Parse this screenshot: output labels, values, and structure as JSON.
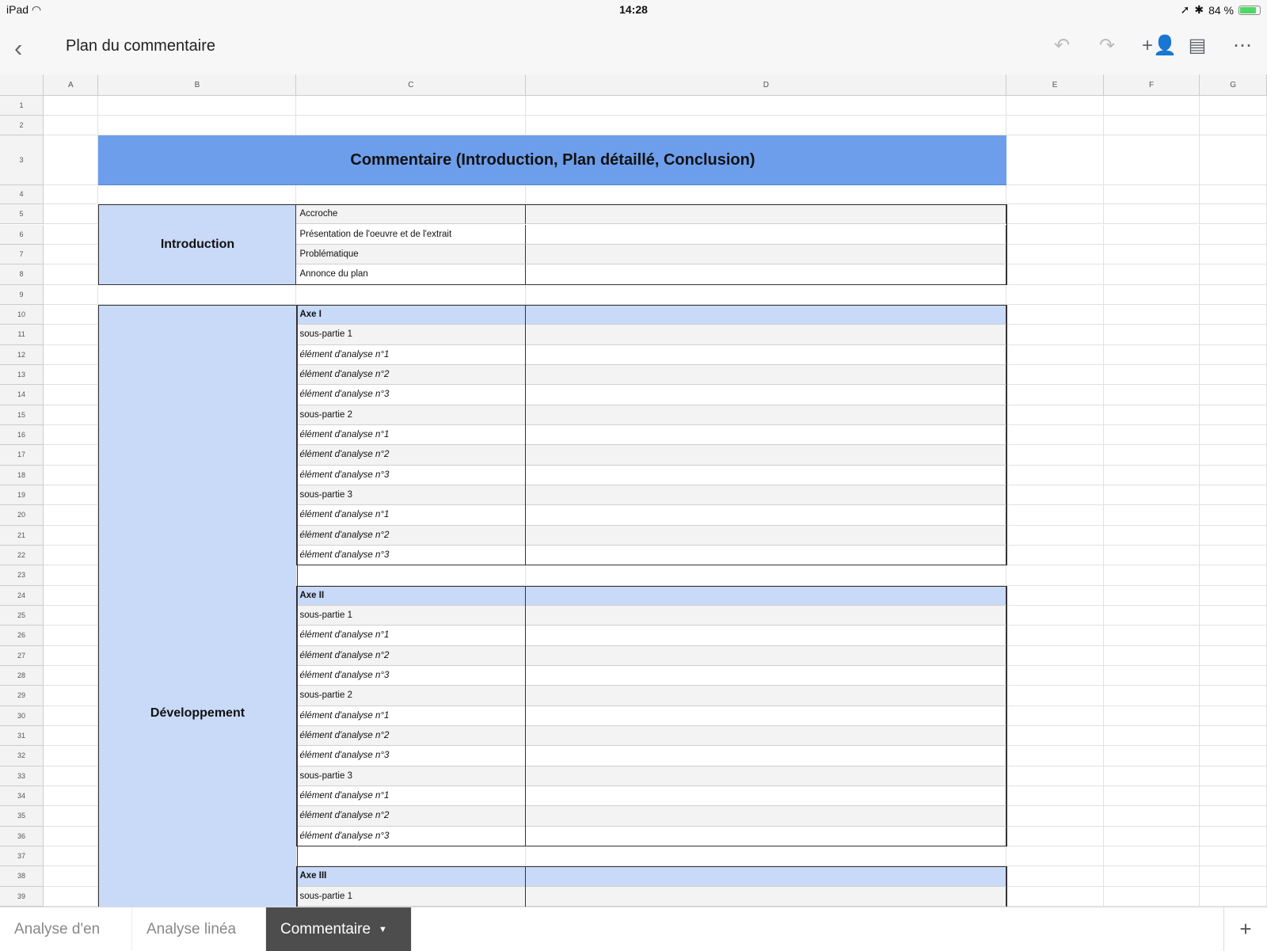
{
  "status_bar": {
    "device": "iPad",
    "time": "14:28",
    "battery": "84 %",
    "battery_level": 0.84,
    "icons": [
      "wifi-icon",
      "location-icon",
      "bluetooth-icon",
      "battery-icon"
    ]
  },
  "app_bar": {
    "title": "Plan du commentaire",
    "icons": [
      "back-icon",
      "undo-icon",
      "redo-icon",
      "add-person-icon",
      "comment-icon",
      "more-icon"
    ]
  },
  "columns": [
    "A",
    "B",
    "C",
    "D",
    "E",
    "F",
    "G"
  ],
  "title_cell": "Commentaire (Introduction, Plan détaillé, Conclusion)",
  "sections": {
    "introduction": "Introduction",
    "developpement": "Développement"
  },
  "rows": [
    {
      "n": "1"
    },
    {
      "n": "2"
    },
    {
      "n": "3"
    },
    {
      "n": "4"
    },
    {
      "n": "5",
      "c": "Accroche",
      "kind": "alt"
    },
    {
      "n": "6",
      "c": "Présentation de l'oeuvre et de l'extrait",
      "kind": "plain"
    },
    {
      "n": "7",
      "c": "Problématique",
      "kind": "alt"
    },
    {
      "n": "8",
      "c": "Annonce du plan",
      "kind": "plain"
    },
    {
      "n": "9"
    },
    {
      "n": "10",
      "c": "Axe I",
      "kind": "axe"
    },
    {
      "n": "11",
      "c": "sous-partie 1",
      "kind": "alt"
    },
    {
      "n": "12",
      "c": "élément d'analyse n°1",
      "kind": "item"
    },
    {
      "n": "13",
      "c": "élément d'analyse n°2",
      "kind": "item-alt"
    },
    {
      "n": "14",
      "c": "élément d'analyse n°3",
      "kind": "item"
    },
    {
      "n": "15",
      "c": "sous-partie 2",
      "kind": "alt"
    },
    {
      "n": "16",
      "c": "élément d'analyse n°1",
      "kind": "item"
    },
    {
      "n": "17",
      "c": "élément d'analyse n°2",
      "kind": "item-alt"
    },
    {
      "n": "18",
      "c": "élément d'analyse n°3",
      "kind": "item"
    },
    {
      "n": "19",
      "c": "sous-partie 3",
      "kind": "alt"
    },
    {
      "n": "20",
      "c": "élément d'analyse n°1",
      "kind": "item"
    },
    {
      "n": "21",
      "c": "élément d'analyse n°2",
      "kind": "item-alt"
    },
    {
      "n": "22",
      "c": "élément d'analyse n°3",
      "kind": "item"
    },
    {
      "n": "23"
    },
    {
      "n": "24",
      "c": "Axe II",
      "kind": "axe"
    },
    {
      "n": "25",
      "c": "sous-partie 1",
      "kind": "alt"
    },
    {
      "n": "26",
      "c": "élément d'analyse n°1",
      "kind": "item"
    },
    {
      "n": "27",
      "c": "élément d'analyse n°2",
      "kind": "item-alt"
    },
    {
      "n": "28",
      "c": "élément d'analyse n°3",
      "kind": "item"
    },
    {
      "n": "29",
      "c": "sous-partie 2",
      "kind": "alt"
    },
    {
      "n": "30",
      "c": "élément d'analyse n°1",
      "kind": "item"
    },
    {
      "n": "31",
      "c": "élément d'analyse n°2",
      "kind": "item-alt"
    },
    {
      "n": "32",
      "c": "élément d'analyse n°3",
      "kind": "item"
    },
    {
      "n": "33",
      "c": "sous-partie 3",
      "kind": "alt"
    },
    {
      "n": "34",
      "c": "élément d'analyse n°1",
      "kind": "item"
    },
    {
      "n": "35",
      "c": "élément d'analyse n°2",
      "kind": "item-alt"
    },
    {
      "n": "36",
      "c": "élément d'analyse n°3",
      "kind": "item"
    },
    {
      "n": "37"
    },
    {
      "n": "38",
      "c": "Axe III",
      "kind": "axe"
    },
    {
      "n": "39",
      "c": "sous-partie 1",
      "kind": "alt"
    }
  ],
  "sheet_tabs": [
    {
      "label": "Analyse d'en",
      "active": false
    },
    {
      "label": "Analyse linéa",
      "active": false
    },
    {
      "label": "Commentaire",
      "active": true
    }
  ],
  "colors": {
    "title_fill": "#6d9eeb",
    "section_fill": "#c9daf8",
    "alt_fill": "#f3f3f3",
    "active_tab": "#4d4d4d"
  }
}
